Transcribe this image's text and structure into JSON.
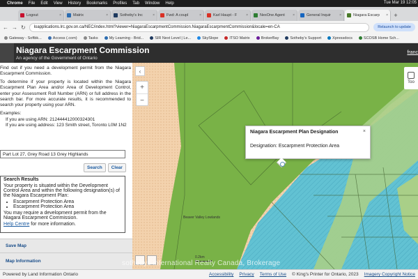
{
  "menubar": {
    "app": "Chrome",
    "items": [
      "File",
      "Edit",
      "View",
      "History",
      "Bookmarks",
      "Profiles",
      "Tab",
      "Window",
      "Help"
    ],
    "clock": "Tue Mar 19  12:05"
  },
  "tabs": [
    {
      "label": "Logout",
      "color": "#c8102e"
    },
    {
      "label": "Matrix",
      "color": "#2b6cb0"
    },
    {
      "label": "Sotheby's Inc",
      "color": "#1f3a5f"
    },
    {
      "label": "Fwd: A coupl",
      "color": "#d93025"
    },
    {
      "label": "Karl Haupt - F",
      "color": "#d93025"
    },
    {
      "label": "NexOne Agent",
      "color": "#2e7d32"
    },
    {
      "label": "General Inquir",
      "color": "#1565c0"
    },
    {
      "label": "Niagara Escarp",
      "color": "#4a7a2a",
      "active": true
    }
  ],
  "address": {
    "url": "loapplications.lrc.gov.on.ca/NEC/index.html?viewer=NiagaraEscarpmentCommission.NiagaraEscarpmentCommission&locale=en-CA",
    "relaunch": "Relaunch to update"
  },
  "bookmarks": [
    {
      "label": "Gateway - Softbk...",
      "color": "#888"
    },
    {
      "label": "Access (.com)",
      "color": "#3a6fb0"
    },
    {
      "label": "Tasks",
      "color": "#888"
    },
    {
      "label": "My Learning - Brid...",
      "color": "#2b6cb0"
    },
    {
      "label": "SIR Next Level | Le...",
      "color": "#1f3a5f"
    },
    {
      "label": "SkySlope",
      "color": "#1e88e5"
    },
    {
      "label": "ITSO Matrix",
      "color": "#c62828"
    },
    {
      "label": "BrokerBay",
      "color": "#6a1b9a"
    },
    {
      "label": "Sotheby's Support",
      "color": "#1f3a5f"
    },
    {
      "label": "Xpressdocs",
      "color": "#0277bd"
    },
    {
      "label": "SCOSB Home Sch...",
      "color": "#2e7d32"
    }
  ],
  "header": {
    "title": "Niagara Escarpment Commission",
    "subtitle": "An agency of the Government of Ontario",
    "user": "franc"
  },
  "panel": {
    "intro": "Find out if you need a development permit from the Niagara Escarpment Commission.",
    "instructions": "To determine if your property is located within the Niagara Escarpment Plan Area and/or Area of Development Control, enter your Assessment Roll Number (ARN) or full address in the search bar. For more accurate results, it is recommended to search your property using your ARN.",
    "examples_label": "Examples:",
    "examples": [
      "If you are using ARN: 212444412000324301",
      "If you are using address: 123 Smith street, Toronto L0M 1N2"
    ],
    "search_value": "Part Lot 27, Grey Road 13 Grey Highlands",
    "search_button": "Search",
    "clear_button": "Clear",
    "results_title": "Search Results",
    "results_text": "Your property is situated within the Development Control Area and within the following designation(s) of the Niagara Escarpment Plan:",
    "designations": [
      "Escarpment Protection Area",
      "Escarpment Protection Area"
    ],
    "permit_text": "You may require a development permit from the Niagara Escarpment Commission.",
    "help_link": "Help Centre",
    "help_suffix": " for more information.",
    "save_map": "Save Map",
    "map_info": "Map Information"
  },
  "map": {
    "popup_title": "Niagara Escarpment Plan Designation",
    "popup_close": "×",
    "popup_body": "Designation: Escarpment Protection Area",
    "tools": "Too",
    "area_label": "Beaver Valley Lowlands",
    "scale": "0.2km",
    "watermark": "sothebys international Realty Canada, Brokerage",
    "colors": {
      "natural_area": "#79b247",
      "protection_area": "#a9cf88",
      "rural_area": "#f3d2ad",
      "water_hatch": "#62c2d3"
    }
  },
  "footer": {
    "powered": "Powered by Land Information Ontario",
    "links": [
      "Accessibility",
      "Privacy",
      "Terms of Use"
    ],
    "copyright": "© King's Printer for Ontario, 2023",
    "imagery": "Imagery Copyright Notice"
  }
}
